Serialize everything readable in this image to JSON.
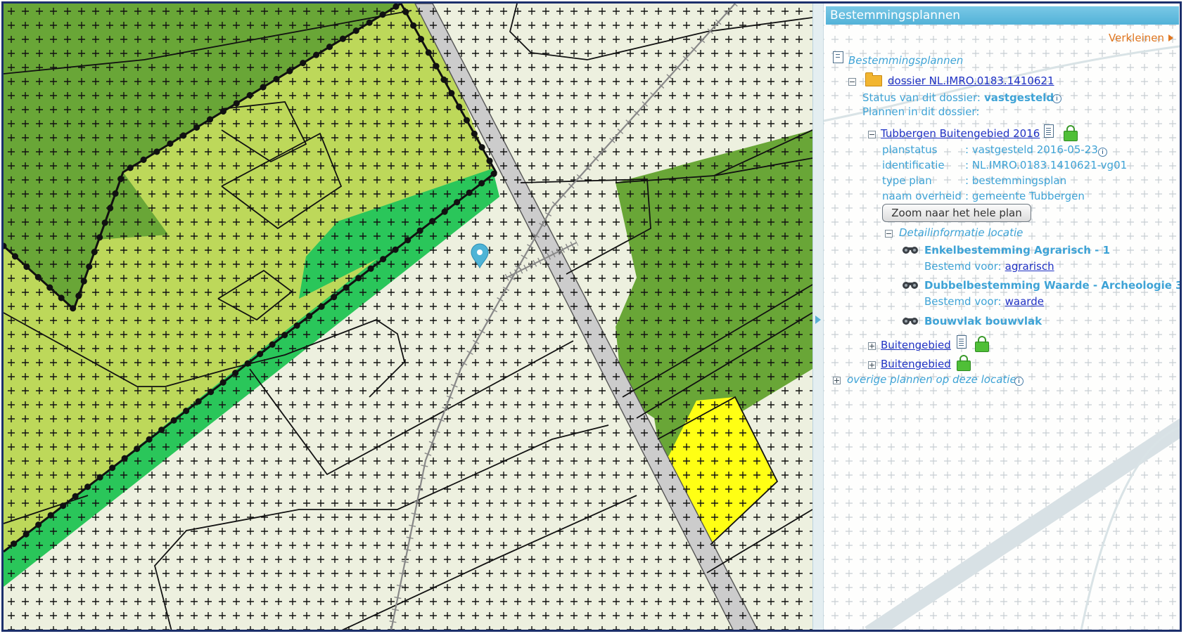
{
  "panel": {
    "title": "Bestemmingsplannen",
    "collapse_label": "Verkleinen",
    "root_label": "Bestemmingsplannen",
    "dossier": {
      "link": "dossier NL.IMRO.0183.1410621",
      "status_label": "Status van dit dossier:",
      "status_value": "vastgesteld",
      "plans_label": "Plannen in dit dossier:"
    },
    "plan": {
      "title": "Tubbergen Buitengebied 2016",
      "fields": [
        {
          "key": "planstatus",
          "value": ": vastgesteld 2016-05-23"
        },
        {
          "key": "identificatie",
          "value": ": NL.IMRO.0183.1410621-vg01"
        },
        {
          "key": "type plan",
          "value": ": bestemmingsplan"
        },
        {
          "key": "naam overheid",
          "value": ": gemeente Tubbergen"
        }
      ],
      "zoom_button": "Zoom naar het hele plan",
      "detail_label": "Detailinformatie locatie",
      "details": [
        {
          "title": "Enkelbestemming Agrarisch - 1",
          "desc_label": "Bestemd voor:",
          "desc_link": "agrarisch"
        },
        {
          "title": "Dubbelbestemming Waarde - Archeologie 3",
          "desc_label": "Bestemd voor:",
          "desc_link": "waarde"
        },
        {
          "title": "Bouwvlak bouwvlak"
        }
      ]
    },
    "other_plans": [
      "Buitengebied",
      "Buitengebied"
    ],
    "overige": "overige plannen op deze locatie"
  },
  "colors": {
    "header": "#55b4da",
    "agrarisch_dark": "#69a637",
    "agrarisch_light": "#bdd85a",
    "green_strip": "#2ac65a",
    "pale": "#edf0df",
    "yellow": "#ffff14",
    "road": "#cccccc"
  }
}
